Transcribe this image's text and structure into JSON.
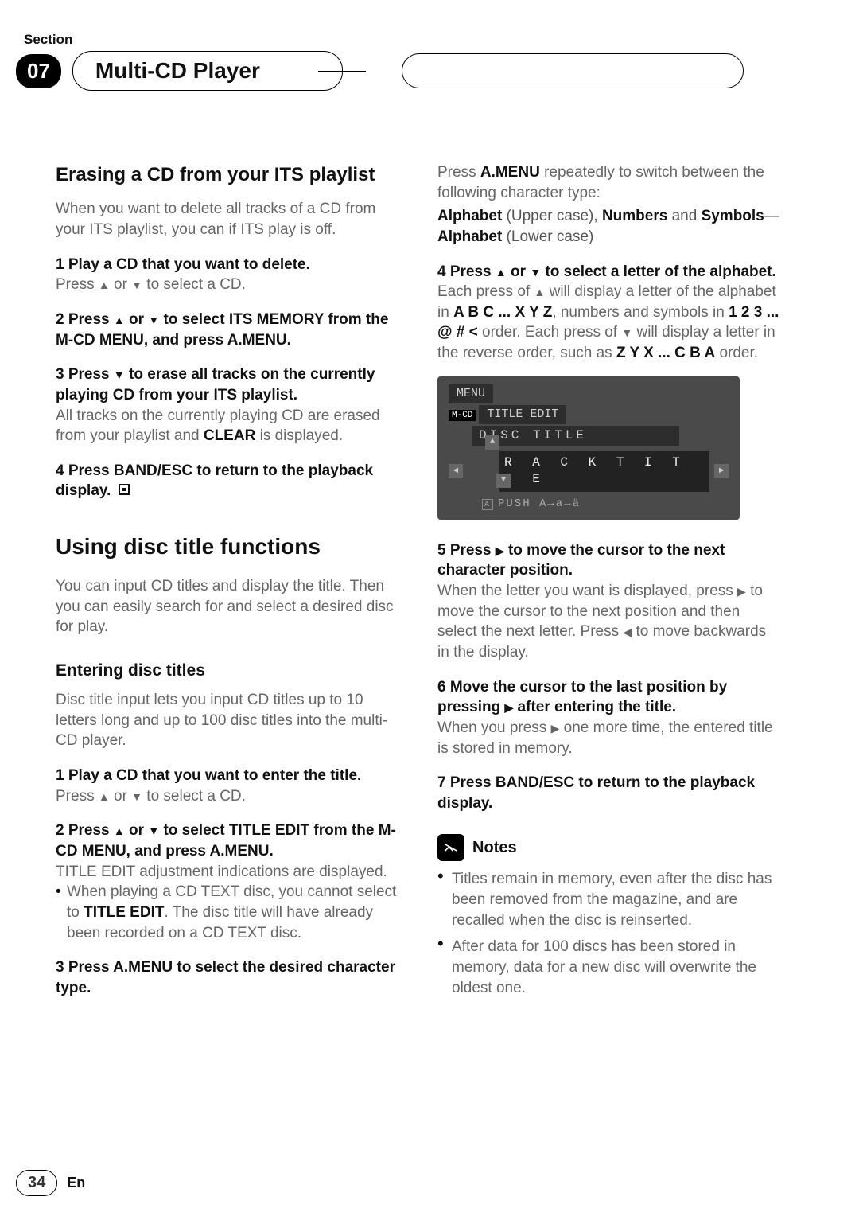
{
  "header": {
    "section_label": "Section",
    "section_number": "07",
    "title": "Multi-CD Player"
  },
  "left": {
    "erase_heading": "Erasing a CD from your ITS playlist",
    "erase_intro": "When you want to delete all tracks of a CD from your ITS playlist, you can if ITS play is off.",
    "step1_head": "1   Play a CD that you want to delete.",
    "step1_body_a": "Press ",
    "step1_body_b": " or ",
    "step1_body_c": " to select a CD.",
    "step2_head_a": "2   Press ",
    "step2_head_b": " or ",
    "step2_head_c": " to select ITS MEMORY from the M-CD MENU, and press A.MENU.",
    "step3_head_a": "3   Press ",
    "step3_head_b": " to erase all tracks on the currently playing CD from your ITS playlist.",
    "step3_body_a": "All tracks on the currently playing CD are erased from your playlist and ",
    "step3_body_clear": "CLEAR",
    "step3_body_b": " is displayed.",
    "step4_head": "4   Press BAND/ESC to return to the playback display.",
    "using_heading": "Using disc title functions",
    "using_intro": "You can input CD titles and display the title. Then you can easily search for and select a desired disc for play.",
    "entering_heading": "Entering disc titles",
    "entering_intro": "Disc title input lets you input CD titles up to 10 letters long and up to 100 disc titles into the multi-CD player.",
    "enter_step1_head": "1   Play a CD that you want to enter the title.",
    "enter_step1_body_a": "Press ",
    "enter_step1_body_b": " or ",
    "enter_step1_body_c": " to select a CD.",
    "enter_step2_head_a": "2   Press ",
    "enter_step2_head_b": " or ",
    "enter_step2_head_c": " to select TITLE EDIT from the M-CD MENU, and press A.MENU.",
    "enter_step2_body": "TITLE EDIT adjustment indications are displayed.",
    "enter_step2_note_a": "When playing a CD TEXT disc, you cannot select to ",
    "enter_step2_note_bold": "TITLE EDIT",
    "enter_step2_note_b": ". The disc title will have already been recorded on a CD TEXT disc.",
    "enter_step3_head": "3   Press A.MENU to select the desired character type."
  },
  "right": {
    "char_intro_a": "Press ",
    "char_intro_bold": "A.MENU",
    "char_intro_b": " repeatedly to switch between the following character type:",
    "char_types_a": "Alphabet",
    "char_types_b": " (Upper case), ",
    "char_types_c": "Numbers",
    "char_types_d": " and ",
    "char_types_e": "Symbols",
    "char_types_dash": "—",
    "char_types_f": "Alphabet",
    "char_types_g": " (Lower case)",
    "rstep4_head_a": "4   Press ",
    "rstep4_head_b": " or ",
    "rstep4_head_c": " to select a letter of the alphabet.",
    "rstep4_body_a": "Each press of ",
    "rstep4_body_b": " will display a letter of the alphabet in ",
    "rstep4_bold1": "A B C ... X Y Z",
    "rstep4_body_c": ", numbers and symbols in ",
    "rstep4_bold2": "1 2 3 ... @ # <",
    "rstep4_body_d": " order. Each press of ",
    "rstep4_body_e": " will display a letter in the reverse order, such as ",
    "rstep4_bold3": "Z Y X ... C B A",
    "rstep4_body_f": " order.",
    "screenshot": {
      "menu": "MENU",
      "mcd": "M-CD",
      "title_edit": "TITLE EDIT",
      "disc_title": "DISC TITLE",
      "letters": "R A C K T I T L E",
      "push": "PUSH   A→a→ä"
    },
    "rstep5_head_a": "5   Press ",
    "rstep5_head_b": " to move the cursor to the next character position.",
    "rstep5_body_a": "When the letter you want is displayed, press ",
    "rstep5_body_b": " to move the cursor to the next position and then select the next letter. Press ",
    "rstep5_body_c": " to move backwards in the display.",
    "rstep6_head_a": "6   Move the cursor to the last position by pressing ",
    "rstep6_head_b": " after entering the title.",
    "rstep6_body_a": "When you press ",
    "rstep6_body_b": " one more time, the entered title is stored in memory.",
    "rstep7_head": "7   Press BAND/ESC to return to the playback display.",
    "notes_title": "Notes",
    "note1": "Titles remain in memory, even after the disc has been removed from the magazine, and are recalled when the disc is reinserted.",
    "note2": "After data for 100 discs has been stored in memory, data for a new disc will overwrite the oldest one."
  },
  "footer": {
    "page": "34",
    "lang": "En"
  }
}
